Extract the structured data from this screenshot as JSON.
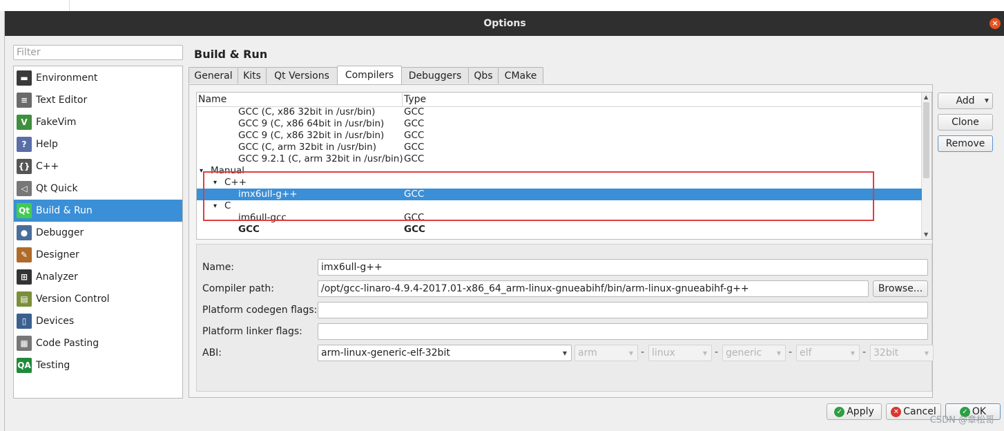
{
  "window": {
    "title": "Options",
    "close_glyph": "×"
  },
  "filter": {
    "placeholder": "Filter",
    "value": ""
  },
  "categories": [
    {
      "label": "Environment",
      "icon": "monitor-icon",
      "icon_glyph": "▬",
      "icon_color": "#3a3a3a"
    },
    {
      "label": "Text Editor",
      "icon": "text-editor-icon",
      "icon_glyph": "≡",
      "icon_color": "#6a6a6a"
    },
    {
      "label": "FakeVim",
      "icon": "fakevim-icon",
      "icon_glyph": "V",
      "icon_color": "#3f8f3f"
    },
    {
      "label": "Help",
      "icon": "help-icon",
      "icon_glyph": "?",
      "icon_color": "#5a6fa8"
    },
    {
      "label": "C++",
      "icon": "cpp-icon",
      "icon_glyph": "{}",
      "icon_color": "#555555"
    },
    {
      "label": "Qt Quick",
      "icon": "qt-quick-icon",
      "icon_glyph": "◁",
      "icon_color": "#777777"
    },
    {
      "label": "Build & Run",
      "icon": "build-run-icon",
      "icon_glyph": "Qt",
      "icon_color": "#41cd52"
    },
    {
      "label": "Debugger",
      "icon": "debugger-icon",
      "icon_glyph": "●",
      "icon_color": "#4a6d9a"
    },
    {
      "label": "Designer",
      "icon": "designer-icon",
      "icon_glyph": "✎",
      "icon_color": "#b06a2a"
    },
    {
      "label": "Analyzer",
      "icon": "analyzer-icon",
      "icon_glyph": "⊞",
      "icon_color": "#333333"
    },
    {
      "label": "Version Control",
      "icon": "version-control-icon",
      "icon_glyph": "▤",
      "icon_color": "#7b8e3a"
    },
    {
      "label": "Devices",
      "icon": "devices-icon",
      "icon_glyph": "▯",
      "icon_color": "#3b5f8f"
    },
    {
      "label": "Code Pasting",
      "icon": "code-pasting-icon",
      "icon_glyph": "▦",
      "icon_color": "#777777"
    },
    {
      "label": "Testing",
      "icon": "testing-icon",
      "icon_glyph": "QA",
      "icon_color": "#1f8a3c"
    }
  ],
  "selected_category": "Build & Run",
  "page_title": "Build & Run",
  "tabs": [
    {
      "label": "General"
    },
    {
      "label": "Kits"
    },
    {
      "label": "Qt Versions"
    },
    {
      "label": "Compilers"
    },
    {
      "label": "Debuggers"
    },
    {
      "label": "Qbs"
    },
    {
      "label": "CMake"
    }
  ],
  "active_tab": "Compilers",
  "tree": {
    "headers": {
      "name": "Name",
      "type": "Type"
    },
    "rows": [
      {
        "name": "GCC (C, x86 32bit in /usr/bin)",
        "type": "GCC",
        "indent": 3
      },
      {
        "name": "GCC 9 (C, x86 64bit in /usr/bin)",
        "type": "GCC",
        "indent": 3
      },
      {
        "name": "GCC 9 (C, x86 32bit in /usr/bin)",
        "type": "GCC",
        "indent": 3
      },
      {
        "name": "GCC (C, arm 32bit in /usr/bin)",
        "type": "GCC",
        "indent": 3
      },
      {
        "name": "GCC 9.2.1 (C, arm 32bit in /usr/bin)",
        "type": "GCC",
        "indent": 3
      },
      {
        "name": "Manual",
        "type": "",
        "indent": 1,
        "expander": "▾"
      },
      {
        "name": "C++",
        "type": "",
        "indent": 2,
        "expander": "▾"
      },
      {
        "name": "imx6ull-g++",
        "type": "GCC",
        "indent": 3,
        "selected": true
      },
      {
        "name": "C",
        "type": "",
        "indent": 2,
        "expander": "▾"
      },
      {
        "name": "im6ull-gcc",
        "type": "GCC",
        "indent": 3
      },
      {
        "name": "GCC",
        "type": "GCC",
        "indent": 3,
        "bold": true
      }
    ]
  },
  "side_buttons": {
    "add": "Add",
    "clone": "Clone",
    "remove": "Remove"
  },
  "form": {
    "name_label": "Name:",
    "name_value": "imx6ull-g++",
    "compiler_path_label": "Compiler path:",
    "compiler_path_value": "/opt/gcc-linaro-4.9.4-2017.01-x86_64_arm-linux-gnueabihf/bin/arm-linux-gnueabihf-g++",
    "browse_label": "Browse...",
    "codegen_label": "Platform codegen flags:",
    "codegen_value": "",
    "linker_label": "Platform linker flags:",
    "linker_value": "",
    "abi_label": "ABI:",
    "abi_value": "arm-linux-generic-elf-32bit",
    "abi_parts": [
      "arm",
      "linux",
      "generic",
      "elf",
      "32bit"
    ],
    "abi_separator": "-"
  },
  "footer": {
    "apply": "Apply",
    "cancel": "Cancel",
    "ok": "OK"
  },
  "watermark": "CSDN @章松哥",
  "colors": {
    "selection": "#3b8fd6",
    "highlight_box": "#e03c3c",
    "title_bar": "#2f2f2f",
    "apply_check": "#2e9e44",
    "cancel_x": "#d9362c",
    "ok_check": "#2e9e44"
  }
}
